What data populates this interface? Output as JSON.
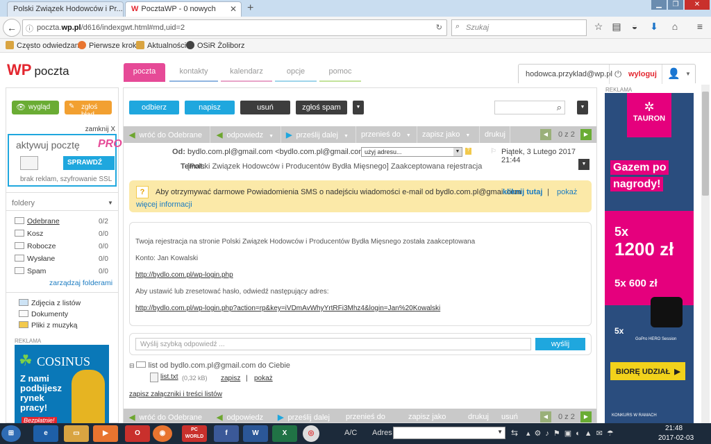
{
  "browser": {
    "tabs": [
      {
        "label": "Polski Związek Hodowców i Pr..."
      },
      {
        "label": "PocztaWP - 0 nowych"
      }
    ],
    "url_prefix": "poczta.",
    "url_domain": "wp.pl",
    "url_path": "/d616/indexgwt.html#md,uid=2",
    "search_placeholder": "Szukaj",
    "bookmarks": [
      "Często odwiedzane",
      "Pierwsze kroki",
      "Aktualności",
      "OSiR Żoliborz"
    ]
  },
  "app": {
    "logo_mark": "WP",
    "logo_text": "poczta",
    "nav": [
      "poczta",
      "kontakty",
      "kalendarz",
      "opcje",
      "pomoc"
    ],
    "user_email": "hodowca.przyklad@wp.pl",
    "logout": "wyloguj"
  },
  "sidebar": {
    "view_btn": "wygląd",
    "report_btn": "zgłoś błąd",
    "close_label": "zamknij X",
    "promo_title": "aktywuj pocztę",
    "promo_pro": "PRO",
    "promo_cta": "SPRAWDŹ",
    "promo_sub": "brak reklam, szyfrowanie SSL",
    "folders_title": "foldery",
    "folders": [
      {
        "name": "Odebrane",
        "count": "0/2"
      },
      {
        "name": "Kosz",
        "count": "0/0"
      },
      {
        "name": "Robocze",
        "count": "0/0"
      },
      {
        "name": "Wysłane",
        "count": "0/0"
      },
      {
        "name": "Spam",
        "count": "0/0"
      }
    ],
    "manage": "zarządzaj folderami",
    "extras": [
      "Zdjęcia z listów",
      "Dokumenty",
      "Pliki z muzyką"
    ],
    "ad_label": "REKLAMA",
    "ad_brand": "COSINUS",
    "ad_text": "Z nami podbijesz rynek pracy!",
    "ad_tag": "Bezpłatnie!"
  },
  "toolbar": {
    "receive": "odbierz",
    "write": "napisz",
    "delete": "usuń",
    "spam": "zgłoś spam"
  },
  "actions": {
    "back": "wróć do Odebrane",
    "reply": "odpowiedz",
    "forward": "prześlij dalej",
    "move": "przenieś do",
    "save": "zapisz jako",
    "print": "drukuj",
    "del": "usuń",
    "pager": "0 z 2"
  },
  "message": {
    "from_label": "Od:",
    "from": "bydlo.com.pl@gmail.com <bydlo.com.pl@gmail.com>",
    "use_address": "użyj adresu...",
    "date": "Piątek, 3 Lutego 2017 21:44",
    "subject_label": "Temat:",
    "subject": "[Polski Związek Hodowców i Producentów Bydła Mięsnego] Zaakceptowana rejestracja",
    "notice": "Aby otrzymywać darmowe Powiadomienia SMS o nadejściu wiadomości e-mail od bydlo.com.pl@gmail.com",
    "notice_link": "kliknij tutaj",
    "notice_more": "pokaż",
    "notice_more2": "więcej informacji",
    "body_line1": "Twoja rejestracja na stronie Polski Związek Hodowców i Producentów Bydła Mięsnego została zaakceptowana",
    "body_line2": "Konto: Jan Kowalski",
    "body_link1": "http://bydlo.com.pl/wp-login.php",
    "body_line3": "Aby ustawić lub zresetować hasło, odwiedź następujący adres:",
    "body_link2": "http://bydlo.com.pl/wp-login.php?action=rp&key=iVDmAvWhyYrtRFi3Mhz4&login=Jan%20Kowalski",
    "quick_reply_placeholder": "Wyślij szybką odpowiedź ...",
    "send": "wyślij",
    "attach_title": "list od bydlo.com.pl@gmail.com do Ciebie",
    "attach_name": "list.txt",
    "attach_size": "(0,32 kB)",
    "attach_save": "zapisz",
    "attach_sep": "|",
    "attach_show": "pokaż",
    "save_all": "zapisz załączniki i treści listów"
  },
  "right_ad": {
    "label": "REKLAMA",
    "brand": "TAURON",
    "headline": "Gazem po nagrody!",
    "big_mult": "5x",
    "big_prize": "1200 zł",
    "small_prize": "5x 600 zł",
    "gopro_mult": "5x",
    "gopro": "GoPro HERO Session",
    "cta": "BIORĘ UDZIAŁ",
    "footer": "KONKURS W RAMACH"
  },
  "taskbar": {
    "ac": "A/C",
    "address": "Adres",
    "time": "21:48",
    "date": "2017-02-03",
    "pcworld": "PC WORLD"
  }
}
